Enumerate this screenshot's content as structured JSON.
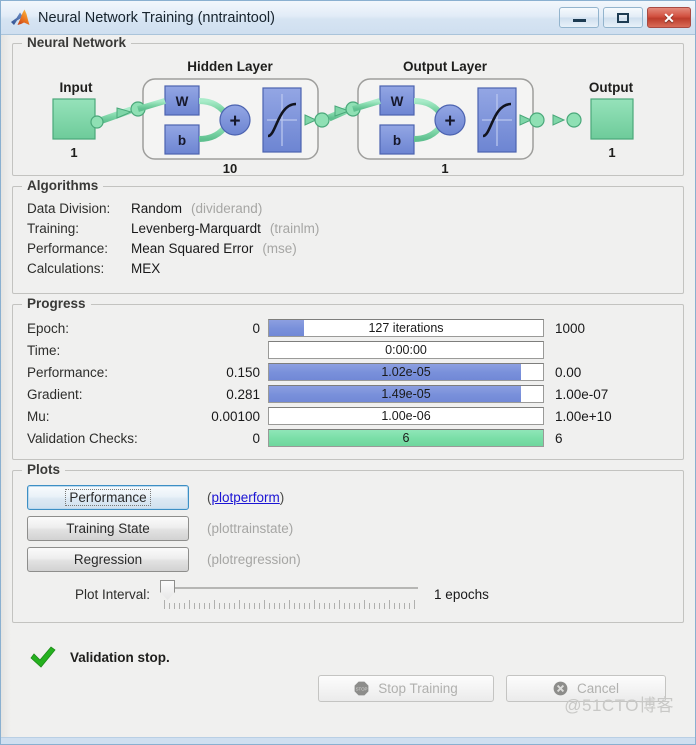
{
  "window": {
    "title": "Neural Network Training (nntraintool)",
    "app_icon": "matlab-membrane-icon",
    "minimize_label": "Minimize",
    "maximize_label": "Maximize",
    "close_label": "Close"
  },
  "neural_network": {
    "group_title": "Neural Network",
    "input_label": "Input",
    "input_size": "1",
    "hidden_layer_label": "Hidden Layer",
    "hidden_size": "10",
    "output_layer_label": "Output Layer",
    "output_layer_size": "1",
    "output_label": "Output",
    "output_size": "1",
    "weight_label": "W",
    "bias_label": "b",
    "sum_label": "+",
    "colors": {
      "data_block": "#7fd6a8",
      "op_block": "#7a91db",
      "connector": "#7fd6a8"
    }
  },
  "algorithms": {
    "group_title": "Algorithms",
    "rows": [
      {
        "label": "Data Division:",
        "value": "Random",
        "fn": "(dividerand)"
      },
      {
        "label": "Training:",
        "value": "Levenberg-Marquardt",
        "fn": "(trainlm)"
      },
      {
        "label": "Performance:",
        "value": "Mean Squared Error",
        "fn": "(mse)"
      },
      {
        "label": "Calculations:",
        "value": "MEX",
        "fn": ""
      }
    ]
  },
  "progress": {
    "group_title": "Progress",
    "rows": [
      {
        "label": "Epoch:",
        "current": "0",
        "bar_text": "127 iterations",
        "max": "1000",
        "fill_pct": 12.7,
        "fill_color": "blue"
      },
      {
        "label": "Time:",
        "current": "",
        "bar_text": "0:00:00",
        "max": "",
        "fill_pct": 0,
        "fill_color": "blue"
      },
      {
        "label": "Performance:",
        "current": "0.150",
        "bar_text": "1.02e-05",
        "max": "0.00",
        "fill_pct": 92,
        "fill_color": "blue"
      },
      {
        "label": "Gradient:",
        "current": "0.281",
        "bar_text": "1.49e-05",
        "max": "1.00e-07",
        "fill_pct": 92,
        "fill_color": "blue"
      },
      {
        "label": "Mu:",
        "current": "0.00100",
        "bar_text": "1.00e-06",
        "max": "1.00e+10",
        "fill_pct": 0,
        "fill_color": "blue"
      },
      {
        "label": "Validation Checks:",
        "current": "0",
        "bar_text": "6",
        "max": "6",
        "fill_pct": 100,
        "fill_color": "green"
      }
    ],
    "colors": {
      "bar_blue": "#7a91db",
      "bar_green": "#7bdfa8"
    }
  },
  "plots": {
    "group_title": "Plots",
    "buttons": [
      {
        "label": "Performance",
        "fn": "plotperform",
        "focused": true,
        "fn_is_link": true
      },
      {
        "label": "Training State",
        "fn": "plottrainstate",
        "focused": false,
        "fn_is_link": false
      },
      {
        "label": "Regression",
        "fn": "plotregression",
        "focused": false,
        "fn_is_link": false
      }
    ],
    "interval_label": "Plot Interval:",
    "interval_value": "1 epochs",
    "slider_position_pct": 0
  },
  "status": {
    "icon": "green-check-icon",
    "text": "Validation stop."
  },
  "footer": {
    "stop_training_label": "Stop Training",
    "stop_training_icon": "stop-sign-icon",
    "stop_training_enabled": false,
    "cancel_label": "Cancel",
    "cancel_icon": "cancel-circle-icon",
    "cancel_enabled": false
  },
  "watermark": {
    "text": "@51CTO博客"
  }
}
